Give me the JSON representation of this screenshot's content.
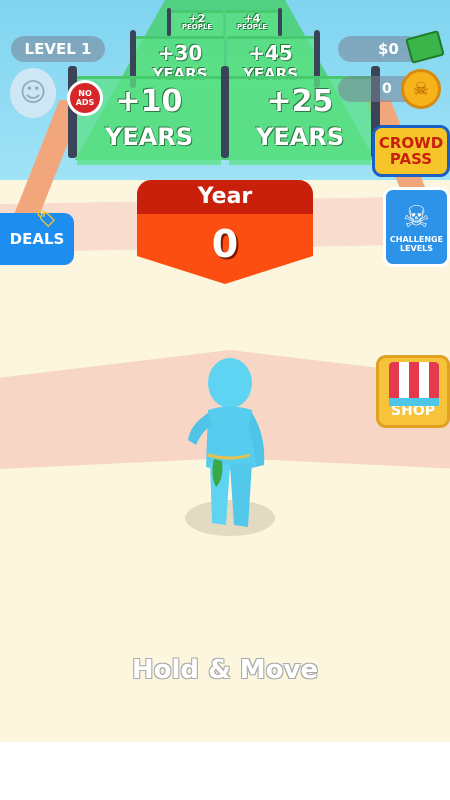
{
  "hud": {
    "level_label": "LEVEL 1",
    "cash": "$0",
    "coins": "0",
    "no_ads_label": "NO ADS"
  },
  "gates": {
    "far": [
      {
        "text": "+2",
        "sub": "PEOPLE"
      },
      {
        "text": "+4",
        "sub": "PEOPLE"
      }
    ],
    "mid": [
      {
        "text": "+30",
        "sub": "YEARS"
      },
      {
        "text": "+45",
        "sub": "YEARS"
      }
    ],
    "near": [
      {
        "text": "+10",
        "sub": "YEARS"
      },
      {
        "text": "+25",
        "sub": "YEARS"
      }
    ]
  },
  "year_banner": {
    "label": "Year",
    "value": "0"
  },
  "side_buttons": {
    "deals": "DEALS",
    "crowd_pass": "CROWD PASS",
    "challenge_levels": "CHALLENGE LEVELS",
    "shop": "SHOP"
  },
  "instruction": "Hold & Move",
  "colors": {
    "banner_top": "#c8200b",
    "banner_bottom": "#fb4e10",
    "gate": "#5ce287",
    "player": "#5fd4f2"
  }
}
